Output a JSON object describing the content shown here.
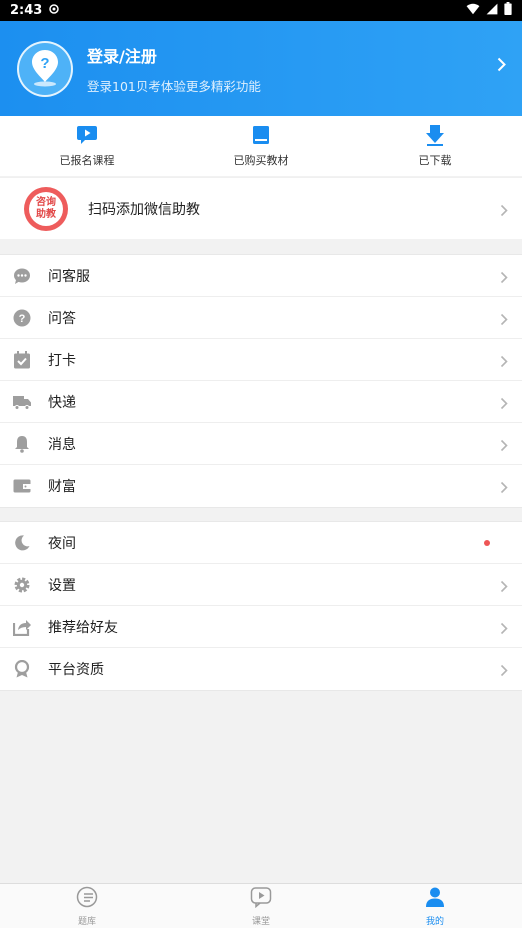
{
  "status_bar": {
    "time": "2:43"
  },
  "header": {
    "title": "登录/注册",
    "subtitle": "登录101贝考体验更多精彩功能"
  },
  "quick_actions": [
    {
      "label": "已报名课程",
      "icon": "play-chat-icon"
    },
    {
      "label": "已购买教材",
      "icon": "book-icon"
    },
    {
      "label": "已下载",
      "icon": "download-icon"
    }
  ],
  "wechat": {
    "badge_top": "咨询",
    "badge_bottom": "助教",
    "label": "扫码添加微信助教"
  },
  "group1": [
    {
      "label": "问客服",
      "icon": "chat-icon"
    },
    {
      "label": "问答",
      "icon": "question-icon"
    },
    {
      "label": "打卡",
      "icon": "calendar-check-icon"
    },
    {
      "label": "快递",
      "icon": "truck-icon"
    },
    {
      "label": "消息",
      "icon": "bell-icon"
    },
    {
      "label": "财富",
      "icon": "wallet-icon"
    }
  ],
  "group2": [
    {
      "label": "夜间",
      "icon": "moon-icon"
    },
    {
      "label": "设置",
      "icon": "gear-icon"
    },
    {
      "label": "推荐给好友",
      "icon": "share-icon"
    },
    {
      "label": "平台资质",
      "icon": "award-icon"
    }
  ],
  "tabs": [
    {
      "label": "题库",
      "icon": "list-icon"
    },
    {
      "label": "课堂",
      "icon": "play-icon"
    },
    {
      "label": "我的",
      "icon": "person-icon",
      "active": true
    }
  ],
  "colors": {
    "primary": "#1a8df0",
    "badge_red": "#ee5c5c",
    "dot_red": "#ee5555"
  }
}
